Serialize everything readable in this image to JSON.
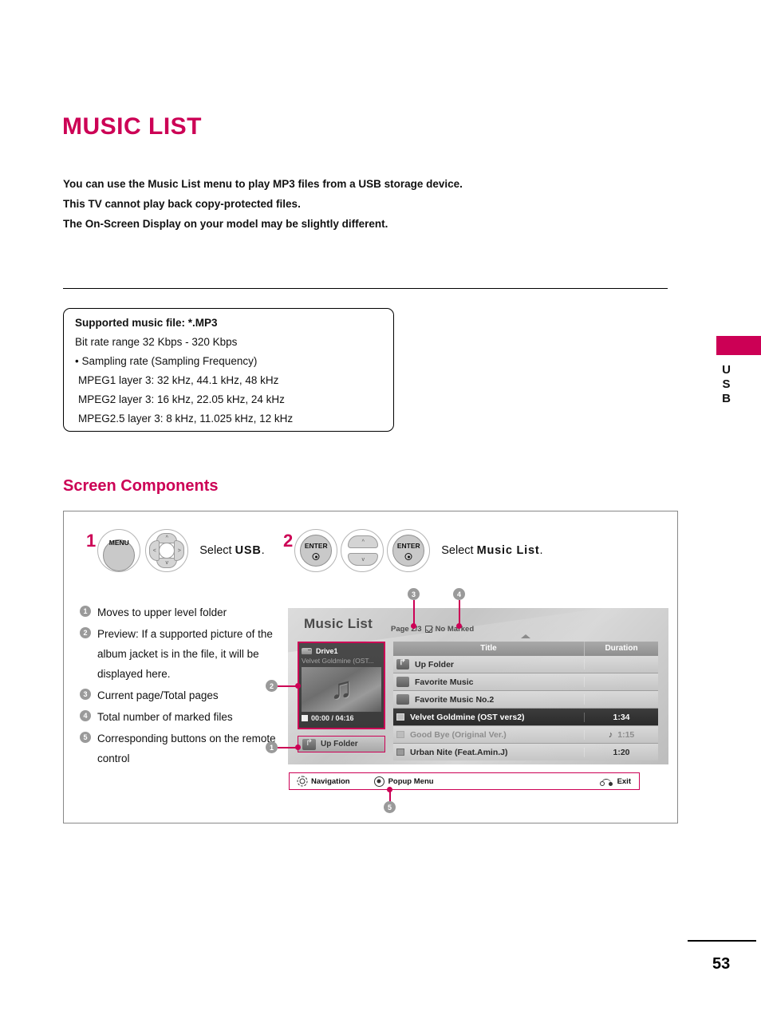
{
  "page": {
    "title": "MUSIC LIST",
    "number": "53",
    "side_tab": "USB"
  },
  "intro": {
    "lines": [
      "You can use the Music List menu to play MP3 files from a USB storage device.",
      "This TV cannot play back copy-protected files.",
      "The On-Screen Display on your model may be slightly different."
    ]
  },
  "spec_box": {
    "lines": [
      "Supported music file: *.MP3",
      "Bit rate range 32 Kbps - 320 Kbps",
      "• Sampling rate (Sampling Frequency)",
      "MPEG1 layer 3: 32 kHz, 44.1 kHz, 48 kHz",
      "MPEG2 layer 3: 16 kHz, 22.05  kHz, 24 kHz",
      "MPEG2.5 layer 3: 8 kHz, 11.025 kHz, 12 kHz"
    ]
  },
  "section": {
    "heading": "Screen Components"
  },
  "steps": [
    {
      "number": "1",
      "buttons": [
        "MENU",
        "nav-pad"
      ],
      "instruction_prefix": "Select ",
      "instruction_bold": "USB",
      "instruction_suffix": "."
    },
    {
      "number": "2",
      "buttons": [
        "ENTER",
        "updown-pad",
        "ENTER"
      ],
      "instruction_prefix": "Select ",
      "instruction_bold": "Music List",
      "instruction_suffix": "."
    }
  ],
  "remote_labels": {
    "menu": "MENU",
    "enter": "ENTER"
  },
  "legend": [
    {
      "num": "1",
      "text": "Moves to upper level folder"
    },
    {
      "num": "2",
      "text": "Preview: If a supported picture of the album jacket is in the file, it will be displayed here."
    },
    {
      "num": "3",
      "text": "Current page/Total pages"
    },
    {
      "num": "4",
      "text": "Total number of marked files"
    },
    {
      "num": "5",
      "text": "Corresponding buttons on the remote control"
    }
  ],
  "tv": {
    "title": "Music List",
    "page_status": "Page 2/3",
    "marked_status": "No Marked",
    "preview": {
      "drive": "Drive1",
      "subtitle": "Velvet Goldmine (OST...",
      "time": "00:00 / 04:16"
    },
    "up_folder_button": "Up Folder",
    "table": {
      "headers": [
        "Title",
        "Duration"
      ],
      "rows": [
        {
          "icon": "up-folder-icon",
          "title": "Up Folder",
          "duration": "",
          "state": "normal"
        },
        {
          "icon": "folder-icon",
          "title": "Favorite Music",
          "duration": "",
          "state": "normal"
        },
        {
          "icon": "folder-icon",
          "title": "Favorite Music No.2",
          "duration": "",
          "state": "normal"
        },
        {
          "icon": "mark-box-icon",
          "title": "Velvet Goldmine (OST vers2)",
          "duration": "1:34",
          "state": "selected"
        },
        {
          "icon": "mark-box-icon",
          "title": "Good Bye (Original Ver.)",
          "duration": "1:15",
          "state": "dim",
          "note": "♪"
        },
        {
          "icon": "mark-box-icon",
          "title": "Urban Nite (Feat.Amin.J)",
          "duration": "1:20",
          "state": "normal"
        }
      ]
    },
    "navbar": {
      "navigation": "Navigation",
      "popup_menu": "Popup Menu",
      "exit": "Exit"
    }
  },
  "callouts": [
    "1",
    "2",
    "3",
    "4",
    "5"
  ],
  "colors": {
    "accent": "#cc0055",
    "callout_gray": "#9a9a9a"
  }
}
